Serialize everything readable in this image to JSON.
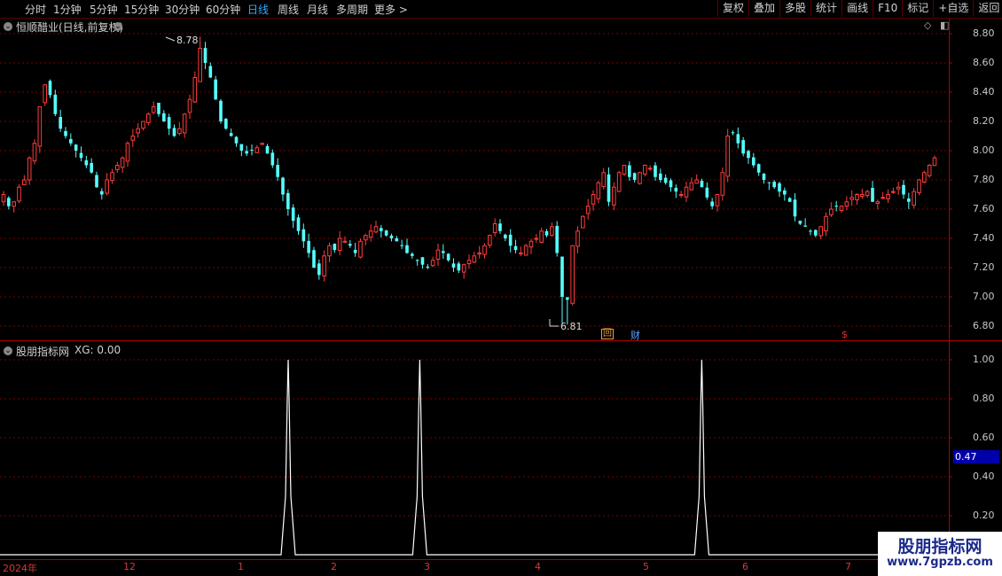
{
  "toolbar": {
    "periods": [
      "分时",
      "1分钟",
      "5分钟",
      "15分钟",
      "30分钟",
      "60分钟",
      "日线",
      "周线",
      "月线",
      "多周期",
      "更多 >"
    ],
    "active_index": 6,
    "buttons": [
      "复权",
      "叠加",
      "多股",
      "统计",
      "画线",
      "F10",
      "标记",
      "+自选",
      "返回"
    ]
  },
  "main_chart": {
    "title": "恒顺醋业(日线,前复权)",
    "y_ticks": [
      "8.80",
      "8.60",
      "8.40",
      "8.20",
      "8.00",
      "7.80",
      "7.60",
      "7.40",
      "7.20",
      "7.00",
      "6.80"
    ],
    "high_label": "8.78",
    "low_label": "6.81",
    "markers": [
      {
        "text": "回",
        "color": "#e8a040"
      },
      {
        "text": "财",
        "color": "#5aa0ff"
      },
      {
        "text": "$",
        "color": "#e03030"
      }
    ]
  },
  "indicator": {
    "title": "股朋指标网",
    "value_label": "XG: 0.00",
    "y_ticks": [
      "1.00",
      "0.80",
      "0.60",
      "0.40",
      "0.20"
    ],
    "current_value": "0.47"
  },
  "x_axis": {
    "labels": [
      "2024年",
      "12",
      "1",
      "2",
      "3",
      "4",
      "5",
      "6",
      "7"
    ]
  },
  "watermark": {
    "title": "股朋指标网",
    "url": "www.7gpzb.com"
  },
  "colors": {
    "up": "#ff3c3c",
    "down": "#54ffff",
    "grid": "#7a0000",
    "signal": "#ffffff"
  },
  "chart_data": {
    "type": "candlestick",
    "title": "恒顺醋业(日线,前复权)",
    "ylim": [
      6.77,
      8.86
    ],
    "y_ticks": [
      8.8,
      8.6,
      8.4,
      8.2,
      8.0,
      7.8,
      7.6,
      7.4,
      7.2,
      7.0,
      6.8
    ],
    "x_labels": [
      "2024年",
      "12",
      "1",
      "2",
      "3",
      "4",
      "5",
      "6",
      "7"
    ],
    "high": 8.78,
    "low": 6.81,
    "close_series": [
      7.7,
      7.62,
      7.65,
      7.75,
      7.8,
      7.95,
      8.05,
      8.3,
      8.45,
      8.38,
      8.25,
      8.15,
      8.1,
      8.05,
      8.0,
      7.95,
      7.9,
      7.85,
      7.75,
      7.7,
      7.8,
      7.85,
      7.9,
      7.95,
      8.05,
      8.1,
      8.15,
      8.2,
      8.25,
      8.3,
      8.25,
      8.2,
      8.15,
      8.1,
      8.15,
      8.25,
      8.35,
      8.5,
      8.7,
      8.6,
      8.5,
      8.35,
      8.2,
      8.15,
      8.1,
      8.05,
      8.0,
      7.98,
      8.0,
      8.02,
      8.05,
      7.98,
      7.9,
      7.82,
      7.7,
      7.6,
      7.52,
      7.45,
      7.38,
      7.3,
      7.2,
      7.15,
      7.28,
      7.35,
      7.32,
      7.4,
      7.38,
      7.35,
      7.3,
      7.38,
      7.42,
      7.45,
      7.48,
      7.45,
      7.42,
      7.4,
      7.38,
      7.35,
      7.3,
      7.28,
      7.25,
      7.22,
      7.2,
      7.25,
      7.32,
      7.3,
      7.25,
      7.2,
      7.18,
      7.22,
      7.25,
      7.28,
      7.3,
      7.35,
      7.42,
      7.5,
      7.45,
      7.4,
      7.35,
      7.32,
      7.3,
      7.35,
      7.38,
      7.4,
      7.45,
      7.42,
      7.48,
      7.3,
      7.0,
      6.98,
      7.35,
      7.45,
      7.55,
      7.62,
      7.7,
      7.78,
      7.85,
      7.65,
      7.75,
      7.85,
      7.9,
      7.82,
      7.8,
      7.85,
      7.9,
      7.88,
      7.82,
      7.8,
      7.78,
      7.75,
      7.72,
      7.7,
      7.75,
      7.78,
      7.8,
      7.75,
      7.68,
      7.62,
      7.7,
      7.85,
      8.1,
      8.12,
      8.05,
      7.98,
      7.95,
      7.9,
      7.85,
      7.8,
      7.78,
      7.75,
      7.72,
      7.7,
      7.65,
      7.55,
      7.5,
      7.48,
      7.45,
      7.42,
      7.48,
      7.55,
      7.6,
      7.62,
      7.62,
      7.65,
      7.68,
      7.7,
      7.7,
      7.72,
      7.65,
      7.65,
      7.68,
      7.7,
      7.72,
      7.75,
      7.7,
      7.65,
      7.72,
      7.8,
      7.85,
      7.9,
      7.95
    ]
  },
  "indicator_data": {
    "type": "line",
    "title": "股朋指标网",
    "ylim": [
      0,
      1
    ],
    "y_ticks": [
      1.0,
      0.8,
      0.6,
      0.4,
      0.2
    ],
    "spikes_at_fraction": [
      0.3,
      0.44,
      0.74
    ],
    "spike_value": 1.0,
    "current_value": 0.47
  }
}
